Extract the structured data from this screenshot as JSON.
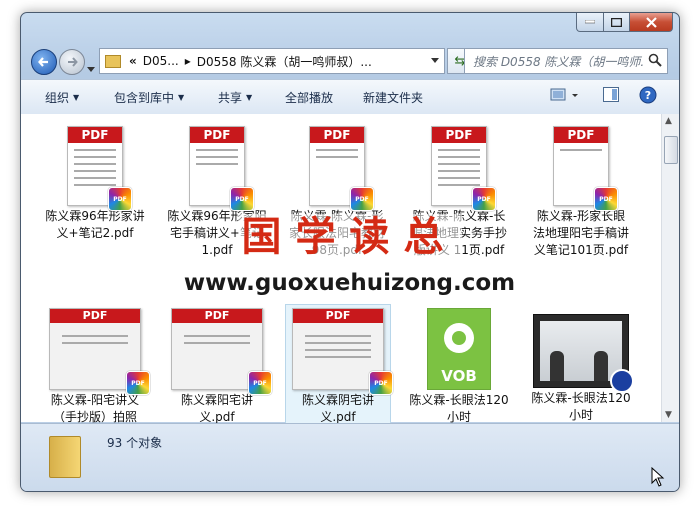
{
  "address": {
    "chevrons": "«",
    "crumbs": [
      "D05...",
      "D0558 陈义霖（胡一鸣师叔）..."
    ]
  },
  "search": {
    "placeholder": "搜索 D0558 陈义霖（胡一鸣师..."
  },
  "toolbar": {
    "organize": "组织",
    "include_library": "包含到库中",
    "share": "共享",
    "play_all": "全部播放",
    "new_folder": "新建文件夹"
  },
  "files": [
    {
      "name": "陈义霖96年形家讲义+笔记2.pdf",
      "type": "pdf"
    },
    {
      "name": "陈义霖96年形家阳宅手稿讲义+笔记1.pdf",
      "type": "pdf"
    },
    {
      "name": "陈义霖-陈义霖-形家长眼法阳宅教材98页.pdf",
      "type": "pdf"
    },
    {
      "name": "陈义霖-陈义霖-长眼法地理实务手抄版讲义 11页.pdf",
      "type": "pdf"
    },
    {
      "name": "陈义霖-形家长眼法地理阳宅手稿讲义笔记101页.pdf",
      "type": "pdf"
    },
    {
      "name": "陈义霖-阳宅讲义（手抄版）拍照",
      "type": "pdf"
    },
    {
      "name": "陈义霖阳宅讲义.pdf",
      "type": "pdf"
    },
    {
      "name": "陈义霖阴宅讲义.pdf",
      "type": "pdf"
    },
    {
      "name": "陈义霖-长眼法120小时",
      "type": "vob",
      "label": "VOB"
    },
    {
      "name": "陈义霖-长眼法120小时",
      "type": "video"
    }
  ],
  "pdf_label": "PDF",
  "status": {
    "count": "93 个对象"
  },
  "watermark": {
    "cn": "国学读总",
    "url": "www.guoxuehuizong.com"
  }
}
